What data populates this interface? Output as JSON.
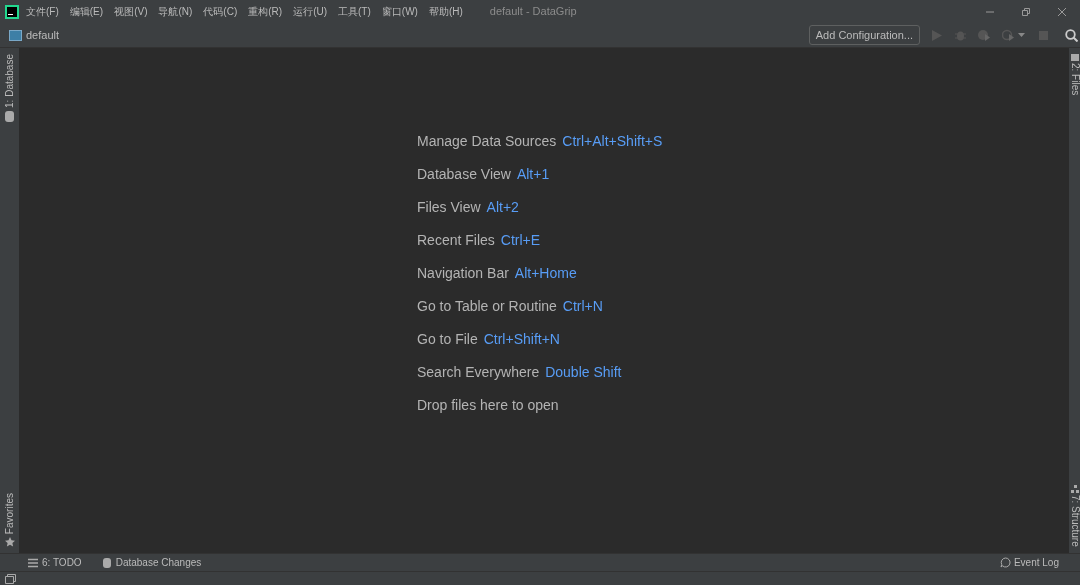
{
  "window": {
    "title": "default - DataGrip"
  },
  "menu": [
    "文件(F)",
    "编辑(E)",
    "视图(V)",
    "导航(N)",
    "代码(C)",
    "重构(R)",
    "运行(U)",
    "工具(T)",
    "窗口(W)",
    "帮助(H)"
  ],
  "navigation": {
    "project": "default",
    "run_config": "Add Configuration..."
  },
  "left_tool_windows": {
    "top": "1: Database",
    "bottom": "Favorites"
  },
  "right_tool_windows": {
    "top": "2: Files",
    "bottom": "7: Structure"
  },
  "hints": [
    {
      "action": "Manage Data Sources",
      "shortcut": "Ctrl+Alt+Shift+S"
    },
    {
      "action": "Database View",
      "shortcut": "Alt+1"
    },
    {
      "action": "Files View",
      "shortcut": "Alt+2"
    },
    {
      "action": "Recent Files",
      "shortcut": "Ctrl+E"
    },
    {
      "action": "Navigation Bar",
      "shortcut": "Alt+Home"
    },
    {
      "action": "Go to Table or Routine",
      "shortcut": "Ctrl+N"
    },
    {
      "action": "Go to File",
      "shortcut": "Ctrl+Shift+N"
    },
    {
      "action": "Search Everywhere",
      "shortcut": "Double Shift"
    },
    {
      "action": "Drop files here to open"
    }
  ],
  "bottom_tool_windows": [
    "6: TODO",
    "Database Changes"
  ],
  "event_log": "Event Log"
}
